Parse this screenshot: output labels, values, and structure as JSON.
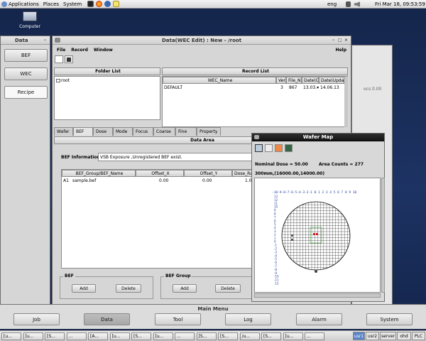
{
  "top_panel": {
    "menus": [
      "Applications",
      "Places",
      "System"
    ],
    "keyboard": "eng",
    "clock": "Fri Mar 18, 09:53:59"
  },
  "desktop": {
    "computer_label": "Computer"
  },
  "data_window": {
    "title": "Data",
    "buttons": [
      "BEF",
      "WEC",
      "Recipe"
    ]
  },
  "wec_window": {
    "title": "Data(WEC Edit) : New - /root",
    "menu": [
      "File",
      "Record",
      "Window"
    ],
    "help": "Help",
    "folder_list": {
      "title": "Folder List",
      "items": [
        "root"
      ]
    },
    "record_list": {
      "title": "Record List",
      "columns": [
        "WEC_Name",
        "Ver.",
        "File_N",
        "Date(Cr",
        "Date(Updat"
      ],
      "rows": [
        [
          "DEFAULT",
          "3",
          "867",
          "13.03.▾",
          "14.06.13"
        ]
      ]
    },
    "tabs": [
      "Wafer",
      "BEF",
      "Dose",
      "Mode",
      "Focus",
      "Coarse",
      "Fine",
      "Property"
    ],
    "data_area": {
      "title": "Data Area",
      "bef_info_label": "BEF Information",
      "bef_info_value": "VSB Exposure ,Unregistered BEF exist.",
      "table": {
        "columns": [
          "BEF_Group/BEF_Name",
          "Offset_X",
          "Offset_Y",
          "Dose_Ratio"
        ],
        "rows": [
          [
            "A1",
            "sample.bef",
            "0.00",
            "0.00",
            "1.00"
          ]
        ]
      },
      "bef_group_box": "BEF",
      "bef_group2_box": "BEF Group",
      "add": "Add",
      "delete": "Delete"
    }
  },
  "background_window": {
    "text": "ocs 0.00"
  },
  "wafer_map": {
    "title": "Wafer Map",
    "nominal_dose": "Nominal Dose = 50.00",
    "area_counts": "Area Counts = 277",
    "size_label": "300mm,(16000.00,14000.00)",
    "x_axis_text": "-10-9-8-7-6-5-4-3-2-1 0 1 2 3 4 5 6 7 8 9 10",
    "y_axis_labels": [
      "13",
      "12",
      "11",
      "10",
      "9",
      "8",
      "7",
      "6",
      "5",
      "4",
      "3",
      "2",
      "1",
      "0",
      "-1",
      "-2",
      "-3",
      "-4",
      "-5",
      "-6",
      "-7",
      "-8",
      "-9",
      "-10",
      "-11",
      "-12"
    ]
  },
  "main_menu": {
    "title": "Main Menu",
    "buttons": [
      "Job",
      "Data",
      "Tool",
      "Log",
      "Alarm",
      "System"
    ],
    "active": "Data"
  },
  "taskbar": {
    "items": [
      "[u...",
      "[u...",
      "[S...",
      "...",
      "[A...",
      "[u...",
      "[S...",
      "[u...",
      "...",
      "[S...",
      "[S...",
      "/u...",
      "[S...",
      "[u...",
      "..."
    ],
    "workspaces": [
      "usr1",
      "usr2",
      "server",
      "ohd",
      "PLC"
    ]
  }
}
